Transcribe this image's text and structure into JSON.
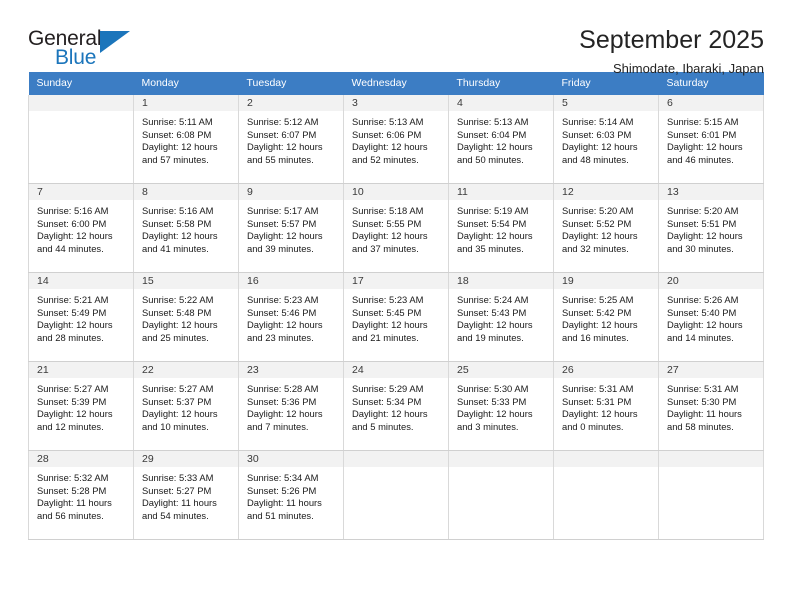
{
  "brand": {
    "name_part1": "General",
    "name_part2": "Blue",
    "triangle_color": "#1b75bb"
  },
  "header": {
    "title": "September 2025",
    "subtitle": "Shimodate, Ibaraki, Japan"
  },
  "theme": {
    "header_bar_color": "#3c7dc4",
    "daynum_bar_color": "#f2f2f2",
    "grid_line_color": "#d9d9d9"
  },
  "weekday_headers": [
    "Sunday",
    "Monday",
    "Tuesday",
    "Wednesday",
    "Thursday",
    "Friday",
    "Saturday"
  ],
  "weeks": [
    [
      {
        "day": "",
        "sunrise": "",
        "sunset": "",
        "daylight1": "",
        "daylight2": "",
        "empty": true
      },
      {
        "day": "1",
        "sunrise": "Sunrise: 5:11 AM",
        "sunset": "Sunset: 6:08 PM",
        "daylight1": "Daylight: 12 hours",
        "daylight2": "and 57 minutes."
      },
      {
        "day": "2",
        "sunrise": "Sunrise: 5:12 AM",
        "sunset": "Sunset: 6:07 PM",
        "daylight1": "Daylight: 12 hours",
        "daylight2": "and 55 minutes."
      },
      {
        "day": "3",
        "sunrise": "Sunrise: 5:13 AM",
        "sunset": "Sunset: 6:06 PM",
        "daylight1": "Daylight: 12 hours",
        "daylight2": "and 52 minutes."
      },
      {
        "day": "4",
        "sunrise": "Sunrise: 5:13 AM",
        "sunset": "Sunset: 6:04 PM",
        "daylight1": "Daylight: 12 hours",
        "daylight2": "and 50 minutes."
      },
      {
        "day": "5",
        "sunrise": "Sunrise: 5:14 AM",
        "sunset": "Sunset: 6:03 PM",
        "daylight1": "Daylight: 12 hours",
        "daylight2": "and 48 minutes."
      },
      {
        "day": "6",
        "sunrise": "Sunrise: 5:15 AM",
        "sunset": "Sunset: 6:01 PM",
        "daylight1": "Daylight: 12 hours",
        "daylight2": "and 46 minutes."
      }
    ],
    [
      {
        "day": "7",
        "sunrise": "Sunrise: 5:16 AM",
        "sunset": "Sunset: 6:00 PM",
        "daylight1": "Daylight: 12 hours",
        "daylight2": "and 44 minutes."
      },
      {
        "day": "8",
        "sunrise": "Sunrise: 5:16 AM",
        "sunset": "Sunset: 5:58 PM",
        "daylight1": "Daylight: 12 hours",
        "daylight2": "and 41 minutes."
      },
      {
        "day": "9",
        "sunrise": "Sunrise: 5:17 AM",
        "sunset": "Sunset: 5:57 PM",
        "daylight1": "Daylight: 12 hours",
        "daylight2": "and 39 minutes."
      },
      {
        "day": "10",
        "sunrise": "Sunrise: 5:18 AM",
        "sunset": "Sunset: 5:55 PM",
        "daylight1": "Daylight: 12 hours",
        "daylight2": "and 37 minutes."
      },
      {
        "day": "11",
        "sunrise": "Sunrise: 5:19 AM",
        "sunset": "Sunset: 5:54 PM",
        "daylight1": "Daylight: 12 hours",
        "daylight2": "and 35 minutes."
      },
      {
        "day": "12",
        "sunrise": "Sunrise: 5:20 AM",
        "sunset": "Sunset: 5:52 PM",
        "daylight1": "Daylight: 12 hours",
        "daylight2": "and 32 minutes."
      },
      {
        "day": "13",
        "sunrise": "Sunrise: 5:20 AM",
        "sunset": "Sunset: 5:51 PM",
        "daylight1": "Daylight: 12 hours",
        "daylight2": "and 30 minutes."
      }
    ],
    [
      {
        "day": "14",
        "sunrise": "Sunrise: 5:21 AM",
        "sunset": "Sunset: 5:49 PM",
        "daylight1": "Daylight: 12 hours",
        "daylight2": "and 28 minutes."
      },
      {
        "day": "15",
        "sunrise": "Sunrise: 5:22 AM",
        "sunset": "Sunset: 5:48 PM",
        "daylight1": "Daylight: 12 hours",
        "daylight2": "and 25 minutes."
      },
      {
        "day": "16",
        "sunrise": "Sunrise: 5:23 AM",
        "sunset": "Sunset: 5:46 PM",
        "daylight1": "Daylight: 12 hours",
        "daylight2": "and 23 minutes."
      },
      {
        "day": "17",
        "sunrise": "Sunrise: 5:23 AM",
        "sunset": "Sunset: 5:45 PM",
        "daylight1": "Daylight: 12 hours",
        "daylight2": "and 21 minutes."
      },
      {
        "day": "18",
        "sunrise": "Sunrise: 5:24 AM",
        "sunset": "Sunset: 5:43 PM",
        "daylight1": "Daylight: 12 hours",
        "daylight2": "and 19 minutes."
      },
      {
        "day": "19",
        "sunrise": "Sunrise: 5:25 AM",
        "sunset": "Sunset: 5:42 PM",
        "daylight1": "Daylight: 12 hours",
        "daylight2": "and 16 minutes."
      },
      {
        "day": "20",
        "sunrise": "Sunrise: 5:26 AM",
        "sunset": "Sunset: 5:40 PM",
        "daylight1": "Daylight: 12 hours",
        "daylight2": "and 14 minutes."
      }
    ],
    [
      {
        "day": "21",
        "sunrise": "Sunrise: 5:27 AM",
        "sunset": "Sunset: 5:39 PM",
        "daylight1": "Daylight: 12 hours",
        "daylight2": "and 12 minutes."
      },
      {
        "day": "22",
        "sunrise": "Sunrise: 5:27 AM",
        "sunset": "Sunset: 5:37 PM",
        "daylight1": "Daylight: 12 hours",
        "daylight2": "and 10 minutes."
      },
      {
        "day": "23",
        "sunrise": "Sunrise: 5:28 AM",
        "sunset": "Sunset: 5:36 PM",
        "daylight1": "Daylight: 12 hours",
        "daylight2": "and 7 minutes."
      },
      {
        "day": "24",
        "sunrise": "Sunrise: 5:29 AM",
        "sunset": "Sunset: 5:34 PM",
        "daylight1": "Daylight: 12 hours",
        "daylight2": "and 5 minutes."
      },
      {
        "day": "25",
        "sunrise": "Sunrise: 5:30 AM",
        "sunset": "Sunset: 5:33 PM",
        "daylight1": "Daylight: 12 hours",
        "daylight2": "and 3 minutes."
      },
      {
        "day": "26",
        "sunrise": "Sunrise: 5:31 AM",
        "sunset": "Sunset: 5:31 PM",
        "daylight1": "Daylight: 12 hours",
        "daylight2": "and 0 minutes."
      },
      {
        "day": "27",
        "sunrise": "Sunrise: 5:31 AM",
        "sunset": "Sunset: 5:30 PM",
        "daylight1": "Daylight: 11 hours",
        "daylight2": "and 58 minutes."
      }
    ],
    [
      {
        "day": "28",
        "sunrise": "Sunrise: 5:32 AM",
        "sunset": "Sunset: 5:28 PM",
        "daylight1": "Daylight: 11 hours",
        "daylight2": "and 56 minutes."
      },
      {
        "day": "29",
        "sunrise": "Sunrise: 5:33 AM",
        "sunset": "Sunset: 5:27 PM",
        "daylight1": "Daylight: 11 hours",
        "daylight2": "and 54 minutes."
      },
      {
        "day": "30",
        "sunrise": "Sunrise: 5:34 AM",
        "sunset": "Sunset: 5:26 PM",
        "daylight1": "Daylight: 11 hours",
        "daylight2": "and 51 minutes."
      },
      {
        "day": "",
        "sunrise": "",
        "sunset": "",
        "daylight1": "",
        "daylight2": "",
        "empty": true
      },
      {
        "day": "",
        "sunrise": "",
        "sunset": "",
        "daylight1": "",
        "daylight2": "",
        "empty": true
      },
      {
        "day": "",
        "sunrise": "",
        "sunset": "",
        "daylight1": "",
        "daylight2": "",
        "empty": true
      },
      {
        "day": "",
        "sunrise": "",
        "sunset": "",
        "daylight1": "",
        "daylight2": "",
        "empty": true
      }
    ]
  ]
}
